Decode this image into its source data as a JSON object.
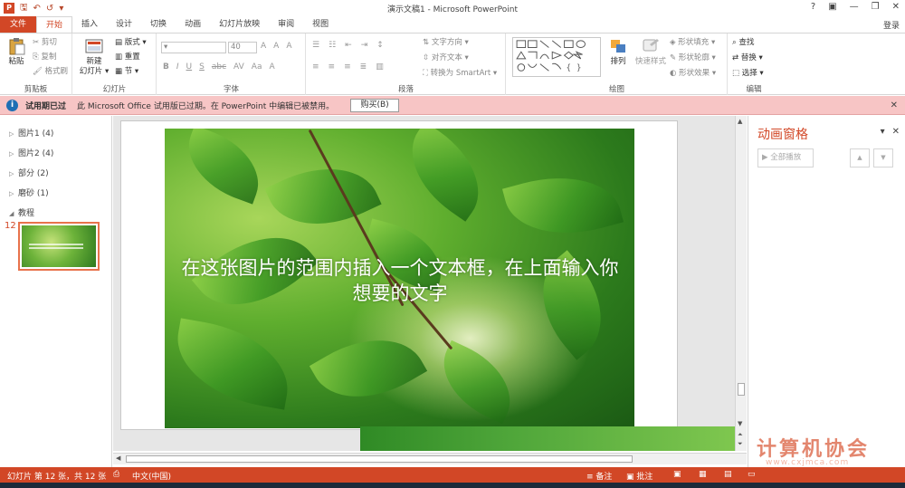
{
  "window": {
    "title": "演示文稿1 - Microsoft PowerPoint",
    "controls": {
      "help": "?",
      "ribbon_display": "▣",
      "minimize": "—",
      "restore": "❐",
      "close": "✕"
    },
    "login": "登录"
  },
  "quick_access": {
    "app": "P",
    "save": "🖫",
    "undo": "↶",
    "redo": "↺",
    "more": "▾"
  },
  "tabs": [
    "文件",
    "开始",
    "插入",
    "设计",
    "切换",
    "动画",
    "幻灯片放映",
    "审阅",
    "视图"
  ],
  "ribbon": {
    "clipboard": {
      "label": "剪贴板",
      "paste": "粘贴",
      "cut": "剪切",
      "copy": "复制",
      "format_painter": "格式刷"
    },
    "slides": {
      "label": "幻灯片",
      "new_slide_line1": "新建",
      "new_slide_line2": "幻灯片 ▾",
      "layout": "版式 ▾",
      "reset": "重置",
      "section": "节 ▾"
    },
    "font": {
      "label": "字体",
      "font_size": "40",
      "bold": "B",
      "italic": "I",
      "underline": "U",
      "strike": "S",
      "shadow": "abc",
      "spacing": "AV",
      "case": "Aa",
      "color": "A",
      "grow": "A",
      "shrink": "A",
      "clear": "A"
    },
    "paragraph": {
      "label": "段落",
      "text_direction": "文字方向 ▾",
      "align_text": "对齐文本 ▾",
      "smartart": "转换为 SmartArt ▾"
    },
    "drawing": {
      "label": "绘图",
      "arrange": "排列",
      "quick_styles": "快速样式",
      "shape_fill": "形状填充 ▾",
      "shape_outline": "形状轮廓 ▾",
      "shape_effects": "形状效果 ▾"
    },
    "editing": {
      "label": "编辑",
      "find": "查找",
      "replace": "替换 ▾",
      "select": "选择 ▾"
    }
  },
  "message_bar": {
    "title": "试用期已过",
    "text": "此 Microsoft Office 试用版已过期。在 PowerPoint 中编辑已被禁用。",
    "button": "购买(B)",
    "close": "✕"
  },
  "outline": {
    "sections": [
      {
        "name": "图片1 (4)",
        "arrow": "▷"
      },
      {
        "name": "图片2 (4)",
        "arrow": "▷"
      },
      {
        "name": "部分 (2)",
        "arrow": "▷"
      },
      {
        "name": "磨砂 (1)",
        "arrow": "▷"
      },
      {
        "name": "教程",
        "arrow": "◢"
      }
    ],
    "current_slide_number": "12"
  },
  "slide": {
    "text": "在这张图片的范围内插入一个文本框，在上面输入你想要的文字"
  },
  "animation_pane": {
    "title": "动画窗格",
    "play_all": "▶ 全部播放",
    "move_up": "▲",
    "move_down": "▼",
    "dropdown": "▾",
    "close": "✕"
  },
  "status_bar": {
    "slide_info": "幻灯片 第 12 张，共 12 张",
    "language": "中文(中国)",
    "notes": "≡ 备注",
    "comments": "▣ 批注"
  },
  "watermark": {
    "text": "计算机协会",
    "url": "www.cxjmca.com"
  }
}
